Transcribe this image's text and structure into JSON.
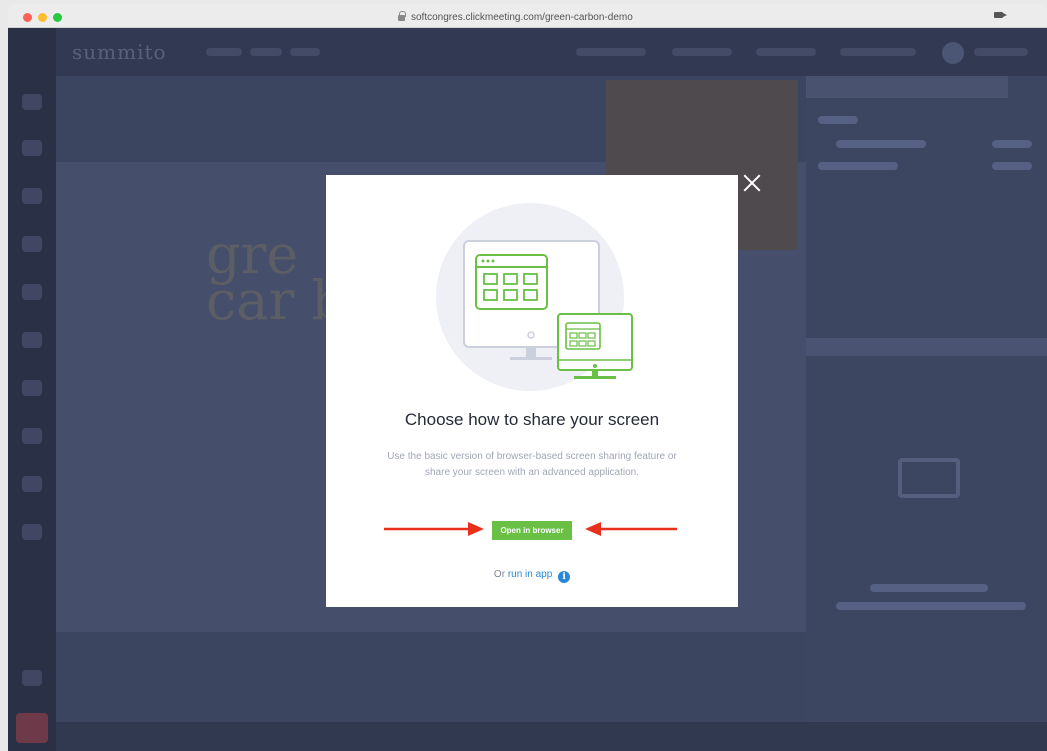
{
  "browser": {
    "url": "softcongres.clickmeeting.com/green-carbon-demo"
  },
  "background": {
    "logo_text": "summito",
    "stage_title_line1": "gre",
    "stage_title_line2": "car b"
  },
  "modal": {
    "title": "Choose how to share your screen",
    "description": "Use the basic version of browser-based screen sharing feature or share your screen with an advanced application.",
    "open_button_label": "Open in browser",
    "or_text": "Or",
    "run_in_app_label": "run in app",
    "info_icon_glyph": "i"
  },
  "colors": {
    "accent_green": "#6abf45",
    "link_blue": "#2a88d6",
    "annotation_red": "#e8301c"
  }
}
